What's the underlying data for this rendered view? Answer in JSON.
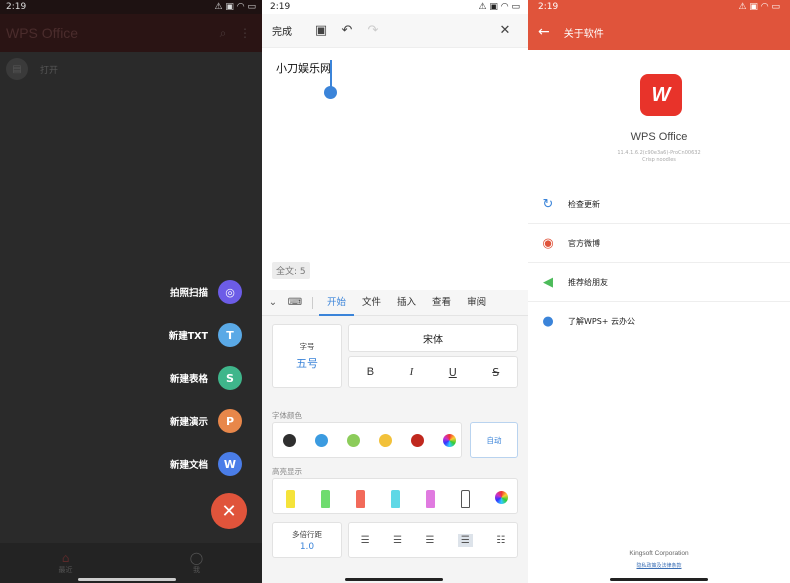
{
  "panel1": {
    "status": {
      "time": "2:19"
    },
    "app_title": "WPS Office",
    "open_label": "打开",
    "fab_items": [
      {
        "label": "拍照扫描",
        "color": "#6c5ce7",
        "glyph": "◎"
      },
      {
        "label": "新建TXT",
        "color": "#5aa9e6",
        "glyph": "T"
      },
      {
        "label": "新建表格",
        "color": "#3fb68b",
        "glyph": "S"
      },
      {
        "label": "新建演示",
        "color": "#e8874a",
        "glyph": "P"
      },
      {
        "label": "新建文档",
        "color": "#4a7de8",
        "glyph": "W"
      }
    ],
    "fab_close": "✕",
    "nav": [
      {
        "label": "最近",
        "icon": "home-icon"
      },
      {
        "label": "我",
        "icon": "person-icon"
      }
    ]
  },
  "panel2": {
    "status": {
      "time": "2:19"
    },
    "done_label": "完成",
    "doc_text": "小刀娱乐网",
    "word_count": "全文: 5",
    "tabs": [
      "开始",
      "文件",
      "插入",
      "查看",
      "审阅"
    ],
    "active_tab": "开始",
    "font_size_label": "字号",
    "font_size_value": "五号",
    "font_name": "宋体",
    "style_buttons": [
      "B",
      "I",
      "U",
      "S"
    ],
    "font_color_label": "字体颜色",
    "font_colors": [
      "#2f2f2f",
      "#3b9be0",
      "#8ccc5a",
      "#f2c13a",
      "#c0281e"
    ],
    "auto_label": "自动",
    "highlight_label": "高亮显示",
    "highlight_colors": [
      "#f5e33a",
      "#6fdc6f",
      "#f26a5a",
      "#5fd8e6",
      "#e07ae0"
    ],
    "line_spacing_label": "多倍行距",
    "line_spacing_value": "1.0"
  },
  "panel3": {
    "status": {
      "time": "2:19"
    },
    "title": "关于软件",
    "logo_letter": "W",
    "app_name": "WPS Office",
    "version_line1": "11.4.1.6.2(c90e3a6)-ProCn00632",
    "version_line2": "Crisp noodles",
    "rows": [
      {
        "label": "检查更新",
        "icon": "refresh-icon",
        "color": "#3b84d9",
        "glyph": "↻"
      },
      {
        "label": "官方微博",
        "icon": "weibo-icon",
        "color": "#e0543b",
        "glyph": "◉"
      },
      {
        "label": "推荐给朋友",
        "icon": "speaker-icon",
        "color": "#4cbb5a",
        "glyph": "◀"
      },
      {
        "label": "了解WPS+ 云办公",
        "icon": "person-icon",
        "color": "#3b84d9",
        "glyph": "●"
      }
    ],
    "footer_company": "Kingsoft Corporation",
    "footer_link": "隐私政策及法律条款"
  }
}
